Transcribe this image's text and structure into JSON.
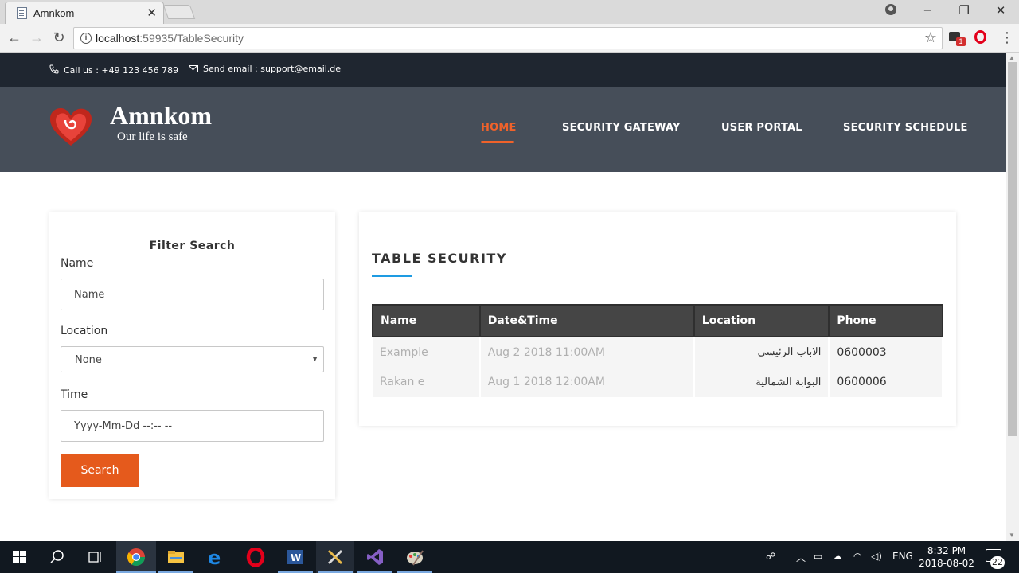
{
  "browser": {
    "tab_title": "Amnkom",
    "url_host": "localhost",
    "url_rest": ":59935/TableSecurity",
    "extension_badge": "1"
  },
  "topbar": {
    "phone_text": "Call us : +49 123 456 789",
    "email_text": "Send email : support@email.de"
  },
  "header": {
    "logo_title": "Amnkom",
    "logo_tagline": "Our life is safe",
    "nav": [
      {
        "label": "HOME",
        "active": true
      },
      {
        "label": "SECURITY GATEWAY",
        "active": false
      },
      {
        "label": "USER PORTAL",
        "active": false
      },
      {
        "label": "SECURITY SCHEDULE",
        "active": false
      }
    ],
    "accent_color": "#f0622a"
  },
  "filter": {
    "title": "Filter Search",
    "name_label": "Name",
    "name_placeholder": "Name",
    "location_label": "Location",
    "location_value": "None",
    "time_label": "Time",
    "time_placeholder": "Yyyy-Mm-Dd --:-- --",
    "search_label": "Search",
    "button_color": "#e55a1c"
  },
  "table": {
    "heading": "TABLE SECURITY",
    "columns": [
      "Name",
      "Date&Time",
      "Location",
      "Phone"
    ],
    "rows": [
      {
        "name": "Example",
        "datetime": "Aug 2 2018 11:00AM",
        "location": "الاباب الرئيسي",
        "phone": "0600003"
      },
      {
        "name": "Rakan e",
        "datetime": "Aug 1 2018 12:00AM",
        "location": "البوابة الشمالية",
        "phone": "0600006"
      }
    ]
  },
  "taskbar": {
    "language": "ENG",
    "time": "8:32 PM",
    "date": "2018-08-02",
    "notification_count": "22"
  }
}
